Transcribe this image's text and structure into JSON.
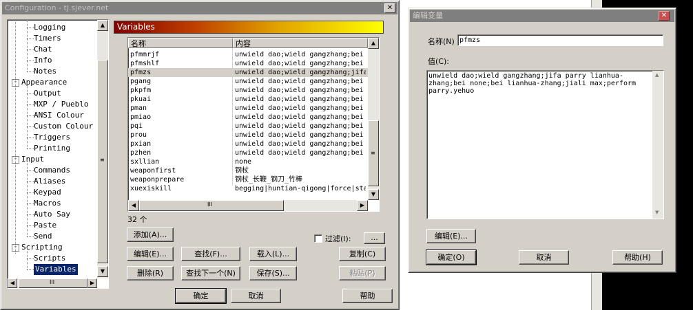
{
  "config_window": {
    "title": "Configuration - tj.sjever.net",
    "tree": [
      {
        "label": "Logging",
        "indent": 2,
        "expander": null
      },
      {
        "label": "Timers",
        "indent": 2,
        "expander": null
      },
      {
        "label": "Chat",
        "indent": 2,
        "expander": null
      },
      {
        "label": "Info",
        "indent": 2,
        "expander": null
      },
      {
        "label": "Notes",
        "indent": 2,
        "expander": null
      },
      {
        "label": "Appearance",
        "indent": 1,
        "expander": "-"
      },
      {
        "label": "Output",
        "indent": 2,
        "expander": null
      },
      {
        "label": "MXP / Pueblo",
        "indent": 2,
        "expander": null
      },
      {
        "label": "ANSI Colour",
        "indent": 2,
        "expander": null
      },
      {
        "label": "Custom Colour",
        "indent": 2,
        "expander": null
      },
      {
        "label": "Triggers",
        "indent": 2,
        "expander": null
      },
      {
        "label": "Printing",
        "indent": 2,
        "expander": null
      },
      {
        "label": "Input",
        "indent": 1,
        "expander": "-"
      },
      {
        "label": "Commands",
        "indent": 2,
        "expander": null
      },
      {
        "label": "Aliases",
        "indent": 2,
        "expander": null
      },
      {
        "label": "Keypad",
        "indent": 2,
        "expander": null
      },
      {
        "label": "Macros",
        "indent": 2,
        "expander": null
      },
      {
        "label": "Auto Say",
        "indent": 2,
        "expander": null
      },
      {
        "label": "Paste",
        "indent": 2,
        "expander": null
      },
      {
        "label": "Send",
        "indent": 2,
        "expander": null
      },
      {
        "label": "Scripting",
        "indent": 1,
        "expander": "-"
      },
      {
        "label": "Scripts",
        "indent": 2,
        "expander": null
      },
      {
        "label": "Variables",
        "indent": 2,
        "expander": null,
        "selected": true
      }
    ],
    "panel_title": "Variables",
    "columns": [
      "名称",
      "内容"
    ],
    "rows": [
      {
        "name": "pfmmrjf",
        "value": "unwield dao;wield gangzhang;bei"
      },
      {
        "name": "pfmshlf",
        "value": "unwield dao;wield gangzhang;bei"
      },
      {
        "name": "pfmzs",
        "value": "unwield dao;wield gangzhang;jifa",
        "selected": true
      },
      {
        "name": "pgang",
        "value": "unwield dao;wield gangzhang;bei"
      },
      {
        "name": "pkpfm",
        "value": "unwield dao;wield gangzhang;bei"
      },
      {
        "name": "pkuai",
        "value": "unwield dao;wield gangzhang;bei"
      },
      {
        "name": "pman",
        "value": "unwield dao;wield gangzhang;bei"
      },
      {
        "name": "pmiao",
        "value": "unwield dao;wield gangzhang;bei"
      },
      {
        "name": "pqi",
        "value": "unwield dao;wield gangzhang;bei"
      },
      {
        "name": "prou",
        "value": "unwield dao;wield gangzhang;bei"
      },
      {
        "name": "pxian",
        "value": "unwield dao;wield gangzhang;bei"
      },
      {
        "name": "pzhen",
        "value": "unwield dao;wield gangzhang;bei"
      },
      {
        "name": "sxllian",
        "value": "none"
      },
      {
        "name": "weaponfirst",
        "value": "钢杖"
      },
      {
        "name": "weaponprepare",
        "value": "钢杖_长鞭_钢刀_竹棒"
      },
      {
        "name": "xuexiskill",
        "value": "begging|huntian-qigong|force|sta"
      }
    ],
    "count_label": "32 个",
    "filter_label": "过滤(I):",
    "filter_btn": "...",
    "buttons": {
      "add": "添加(A)...",
      "edit": "编辑(E)...",
      "find": "查找(F)...",
      "load": "载入(L)...",
      "copy": "复制(C)",
      "delete": "删除(R)",
      "find_next": "查找下一个(N)",
      "save": "保存(S)...",
      "paste": "粘贴(P)",
      "ok": "确定",
      "cancel": "取消",
      "help": "帮助"
    }
  },
  "edit_dialog": {
    "title": "编辑变量",
    "name_label": "名称(N)",
    "name_value": "pfmzs",
    "value_label": "值(C):",
    "value_text": "unwield dao;wield gangzhang;jifa parry lianhua-zhang;bei none;bei lianhua-zhang;jiali max;perform parry.yehuo",
    "edit_btn": "编辑(E)...",
    "ok_btn": "确定(O)",
    "cancel_btn": "取消",
    "help_btn": "帮助(H)"
  }
}
